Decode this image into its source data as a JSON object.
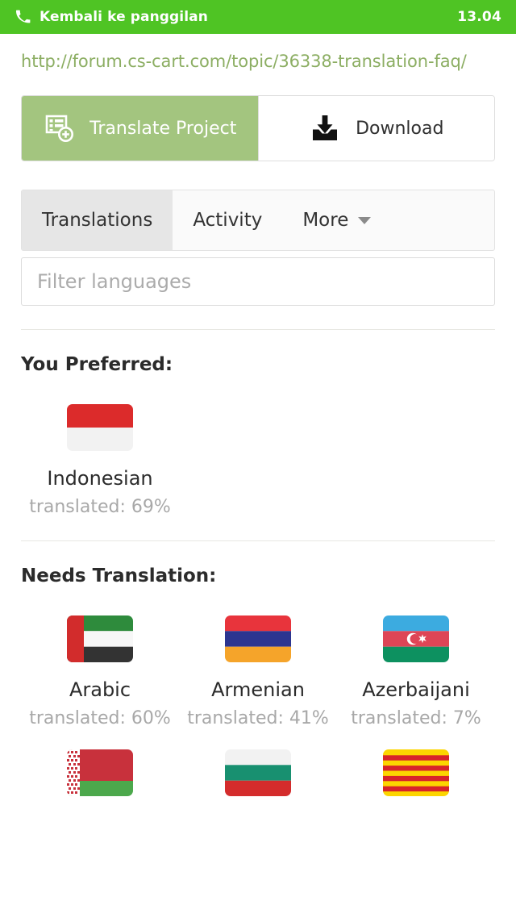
{
  "statusbar": {
    "call_label": "Kembali ke panggilan",
    "phone_icon": "phone-handset-icon",
    "time": "13.04",
    "bg_color": "#4FC424",
    "fg_color": "#FFFFFF"
  },
  "url": {
    "text": "http://forum.cs-cart.com/topic/36338-translation-faq/",
    "color": "#8CAE63"
  },
  "actions": {
    "translate": {
      "label": "Translate Project",
      "icon": "document-list-add-icon",
      "bg_color": "#A3C57F",
      "active": true
    },
    "download": {
      "label": "Download",
      "icon": "download-tray-icon",
      "bg_color": "#FFFFFF",
      "active": false
    }
  },
  "tabs": [
    {
      "label": "Translations",
      "active": true
    },
    {
      "label": "Activity",
      "active": false
    },
    {
      "label": "More",
      "active": false,
      "caret_icon": "chevron-down-icon"
    }
  ],
  "filter": {
    "placeholder": "Filter languages",
    "value": ""
  },
  "sections": [
    {
      "title": "You Preferred:",
      "languages": [
        {
          "name": "Indonesian",
          "progress_label": "translated: 69%",
          "percent": 69,
          "flag": "indonesia"
        }
      ]
    },
    {
      "title": "Needs Translation:",
      "languages": [
        {
          "name": "Arabic",
          "progress_label": "translated: 60%",
          "percent": 60,
          "flag": "uae"
        },
        {
          "name": "Armenian",
          "progress_label": "translated: 41%",
          "percent": 41,
          "flag": "armenia"
        },
        {
          "name": "Azerbaijani",
          "progress_label": "translated: 7%",
          "percent": 7,
          "flag": "azerbaijan"
        },
        {
          "name": "",
          "progress_label": "",
          "percent": null,
          "flag": "belarus"
        },
        {
          "name": "",
          "progress_label": "",
          "percent": null,
          "flag": "bulgaria"
        },
        {
          "name": "",
          "progress_label": "",
          "percent": null,
          "flag": "catalan"
        }
      ]
    }
  ]
}
